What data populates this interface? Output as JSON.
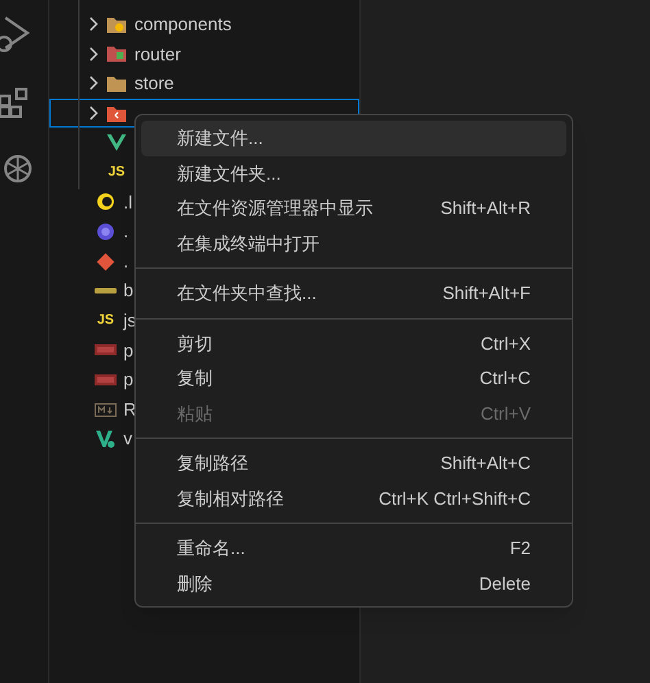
{
  "src_children": [
    {
      "kind": "componentsfolder",
      "label": "components",
      "selected": false
    },
    {
      "kind": "routerfolder",
      "label": "router",
      "selected": false
    },
    {
      "kind": "storefolder",
      "label": "store",
      "selected": false
    },
    {
      "kind": "viewsfolder",
      "selected": true
    },
    {
      "kind": "vuefile"
    },
    {
      "kind": "jsfile",
      "badge": "JS"
    }
  ],
  "root_files": [
    {
      "kind": "babelfile",
      "label": ".l"
    },
    {
      "kind": "editorconfigfile",
      "label": "."
    },
    {
      "kind": "gitfile",
      "label": "."
    },
    {
      "kind": "jsonfile",
      "label": "b"
    },
    {
      "kind": "jsfile",
      "badge": "JS",
      "label": "js"
    },
    {
      "kind": "npmfile",
      "label": "p"
    },
    {
      "kind": "npmfile",
      "label": "p"
    },
    {
      "kind": "markdownfile",
      "label": "R"
    },
    {
      "kind": "vitefile",
      "label": "v"
    }
  ],
  "context_menu": [
    [
      {
        "label": "新建文件...",
        "selected": true,
        "disabled": false
      },
      {
        "label": "新建文件夹...",
        "selected": false,
        "disabled": false
      },
      {
        "label": "在文件资源管理器中显示",
        "shortcut": "Shift+Alt+R",
        "selected": false,
        "disabled": false
      },
      {
        "label": "在集成终端中打开",
        "selected": false,
        "disabled": false
      }
    ],
    [
      {
        "label": "在文件夹中查找...",
        "shortcut": "Shift+Alt+F",
        "selected": false,
        "disabled": false
      }
    ],
    [
      {
        "label": "剪切",
        "shortcut": "Ctrl+X",
        "selected": false,
        "disabled": false
      },
      {
        "label": "复制",
        "shortcut": "Ctrl+C",
        "selected": false,
        "disabled": false
      },
      {
        "label": "粘贴",
        "shortcut": "Ctrl+V",
        "selected": false,
        "disabled": true
      }
    ],
    [
      {
        "label": "复制路径",
        "shortcut": "Shift+Alt+C",
        "selected": false,
        "disabled": false
      },
      {
        "label": "复制相对路径",
        "shortcut": "Ctrl+K Ctrl+Shift+C",
        "selected": false,
        "disabled": false
      }
    ],
    [
      {
        "label": "重命名...",
        "shortcut": "F2",
        "selected": false,
        "disabled": false
      },
      {
        "label": "删除",
        "shortcut": "Delete",
        "selected": false,
        "disabled": false
      }
    ]
  ]
}
